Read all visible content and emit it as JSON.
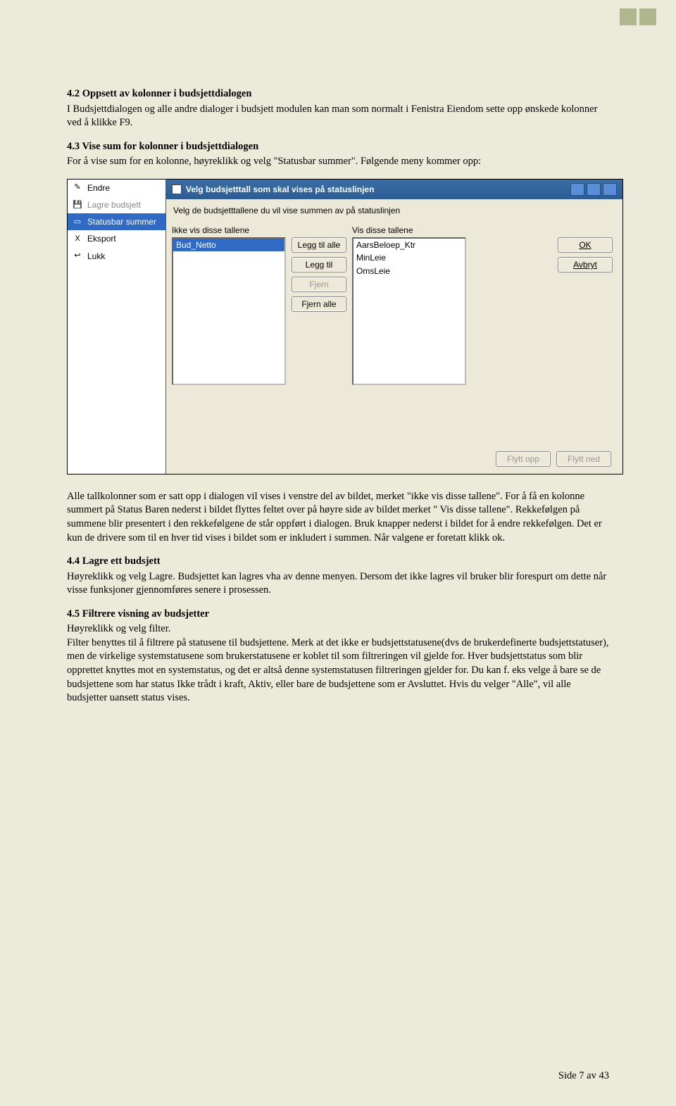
{
  "sections": {
    "s1": {
      "title": "4.2 Oppsett av kolonner i budsjettdialogen",
      "body": "I Budsjettdialogen og alle andre dialoger i budsjett modulen kan man som normalt i Fenistra Eiendom sette opp ønskede kolonner ved å klikke F9."
    },
    "s2": {
      "title": "4.3 Vise sum for kolonner i budsjettdialogen",
      "body": "For å vise sum for en kolonne, høyreklikk og velg \"Statusbar summer\". Følgende meny kommer opp:"
    },
    "s3": {
      "body": "Alle tallkolonner som er satt opp i dialogen vil vises i venstre del av bildet, merket \"ikke vis disse tallene\". For å få en kolonne summert på Status Baren nederst i bildet flyttes feltet over på høyre side av bildet merket \" Vis disse tallene\". Rekkefølgen på summene blir presentert i den rekkefølgene de står oppført i dialogen. Bruk knapper nederst i bildet for å endre rekkefølgen. Det er kun de drivere som til en hver tid vises i bildet som er inkludert i summen. Når valgene er foretatt klikk ok."
    },
    "s4": {
      "title": "4.4 Lagre ett budsjett",
      "body": "Høyreklikk og velg Lagre. Budsjettet kan lagres vha av denne menyen. Dersom det ikke lagres vil bruker blir forespurt om dette når visse funksjoner gjennomføres senere i prosessen."
    },
    "s5": {
      "title": "4.5 Filtrere visning av budsjetter",
      "body": " Høyreklikk og velg filter.\n Filter benyttes til å filtrere på statusene til budsjettene. Merk at det ikke er budsjettstatusene(dvs de brukerdefinerte budsjettstatuser), men de virkelige systemstatusene som brukerstatusene er koblet til som filtreringen vil gjelde for. Hver budsjettstatus som blir opprettet knyttes mot en systemstatus, og det er altså denne systemstatusen filtreringen gjelder for. Du kan f. eks velge å bare se de budsjettene som har status Ikke trådt i kraft, Aktiv, eller bare de budsjettene som er Avsluttet. Hvis du velger \"Alle\", vil alle budsjetter uansett status vises."
    }
  },
  "context_menu": {
    "items": [
      {
        "icon": "✎",
        "label": "Endre"
      },
      {
        "icon": "💾",
        "label": "Lagre budsjett",
        "disabled": true
      },
      {
        "icon": "▭",
        "label": "Statusbar summer",
        "selected": true
      },
      {
        "icon": "X",
        "label": "Eksport"
      },
      {
        "icon": "↩",
        "label": "Lukk"
      }
    ]
  },
  "dialog": {
    "title": "Velg budsjetttall som skal vises på statuslinjen",
    "prompt": "Velg de budsjetttallene du vil vise summen av på statuslinjen",
    "left_label": "Ikke vis disse tallene",
    "right_label": "Vis disse tallene",
    "left_items": [
      "Bud_Netto"
    ],
    "right_items": [
      "AarsBeloep_Ktr",
      "MinLeie",
      "OmsLeie"
    ],
    "buttons": {
      "add_all": "Legg til alle",
      "add": "Legg til",
      "remove": "Fjern",
      "remove_all": "Fjern alle",
      "ok": "OK",
      "cancel": "Avbryt",
      "move_up": "Flytt opp",
      "move_down": "Flytt ned"
    }
  },
  "footer": "Side 7 av 43"
}
